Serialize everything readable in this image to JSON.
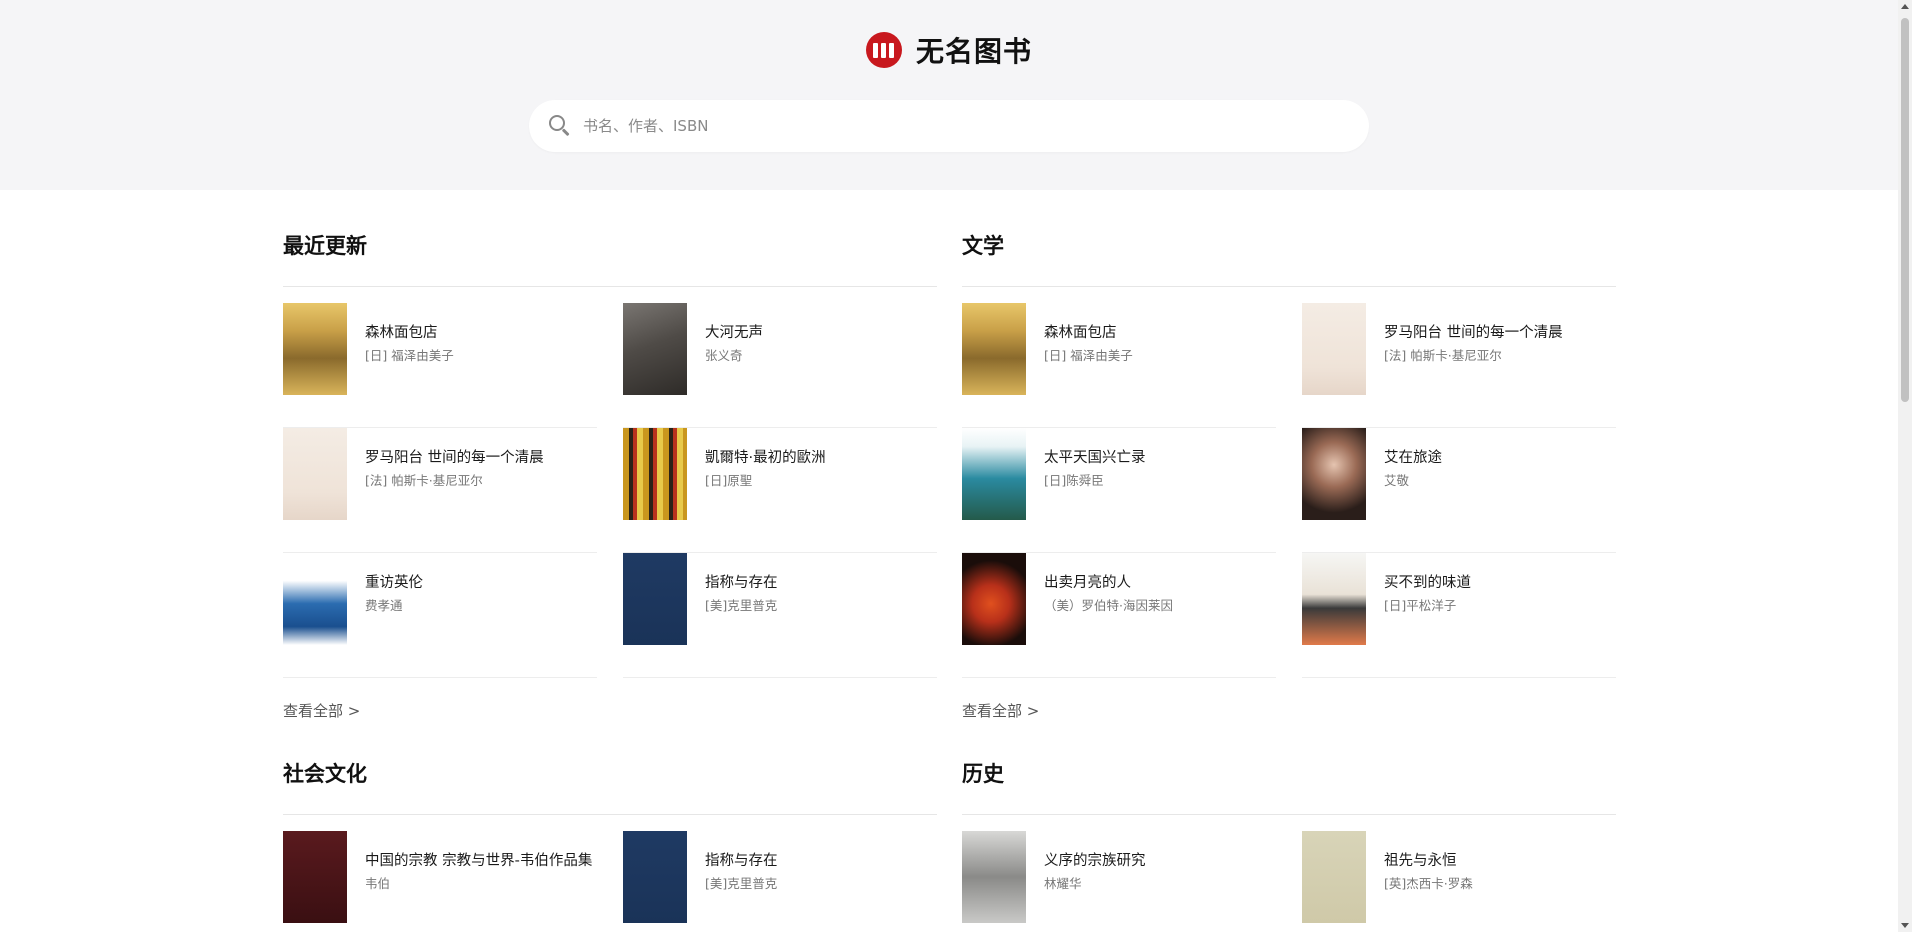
{
  "site": {
    "title": "无名图书",
    "brand_color": "#c8181e"
  },
  "search": {
    "placeholder": "书名、作者、ISBN",
    "value": ""
  },
  "sections": [
    {
      "title": "最近更新",
      "view_all": "查看全部 >",
      "books": [
        {
          "title": "森林面包店",
          "author": "[日] 福泽由美子",
          "cover": "forest"
        },
        {
          "title": "大河无声",
          "author": "张义奇",
          "cover": "river"
        },
        {
          "title": "罗马阳台 世间的每一个清晨",
          "author": "[法] 帕斯卡·基尼亚尔",
          "cover": "roma"
        },
        {
          "title": "凱爾特·最初的歐洲",
          "author": "[日]原聖",
          "cover": "celt"
        },
        {
          "title": "重访英伦",
          "author": "费孝通",
          "cover": "england"
        },
        {
          "title": "指称与存在",
          "author": "[美]克里普克",
          "cover": "navy"
        }
      ]
    },
    {
      "title": "文学",
      "view_all": "查看全部 >",
      "books": [
        {
          "title": "森林面包店",
          "author": "[日] 福泽由美子",
          "cover": "forest"
        },
        {
          "title": "罗马阳台 世间的每一个清晨",
          "author": "[法] 帕斯卡·基尼亚尔",
          "cover": "roma"
        },
        {
          "title": "太平天国兴亡录",
          "author": "[日]陈舜臣",
          "cover": "taiping"
        },
        {
          "title": "艾在旅途",
          "author": "艾敬",
          "cover": "portrait"
        },
        {
          "title": "出卖月亮的人",
          "author": "（美）罗伯特·海因莱因",
          "cover": "moon"
        },
        {
          "title": "买不到的味道",
          "author": "[日]平松洋子",
          "cover": "food"
        }
      ]
    },
    {
      "title": "社会文化",
      "view_all": "",
      "books": [
        {
          "title": "中国的宗教 宗教与世界-韦伯作品集",
          "author": "韦伯",
          "cover": "weber"
        },
        {
          "title": "指称与存在",
          "author": "[美]克里普克",
          "cover": "navy"
        }
      ]
    },
    {
      "title": "历史",
      "view_all": "",
      "books": [
        {
          "title": "义序的宗族研究",
          "author": "林耀华",
          "cover": "clan"
        },
        {
          "title": "祖先与永恒",
          "author": "[英]杰西卡·罗森",
          "cover": "ancestor"
        }
      ]
    }
  ]
}
